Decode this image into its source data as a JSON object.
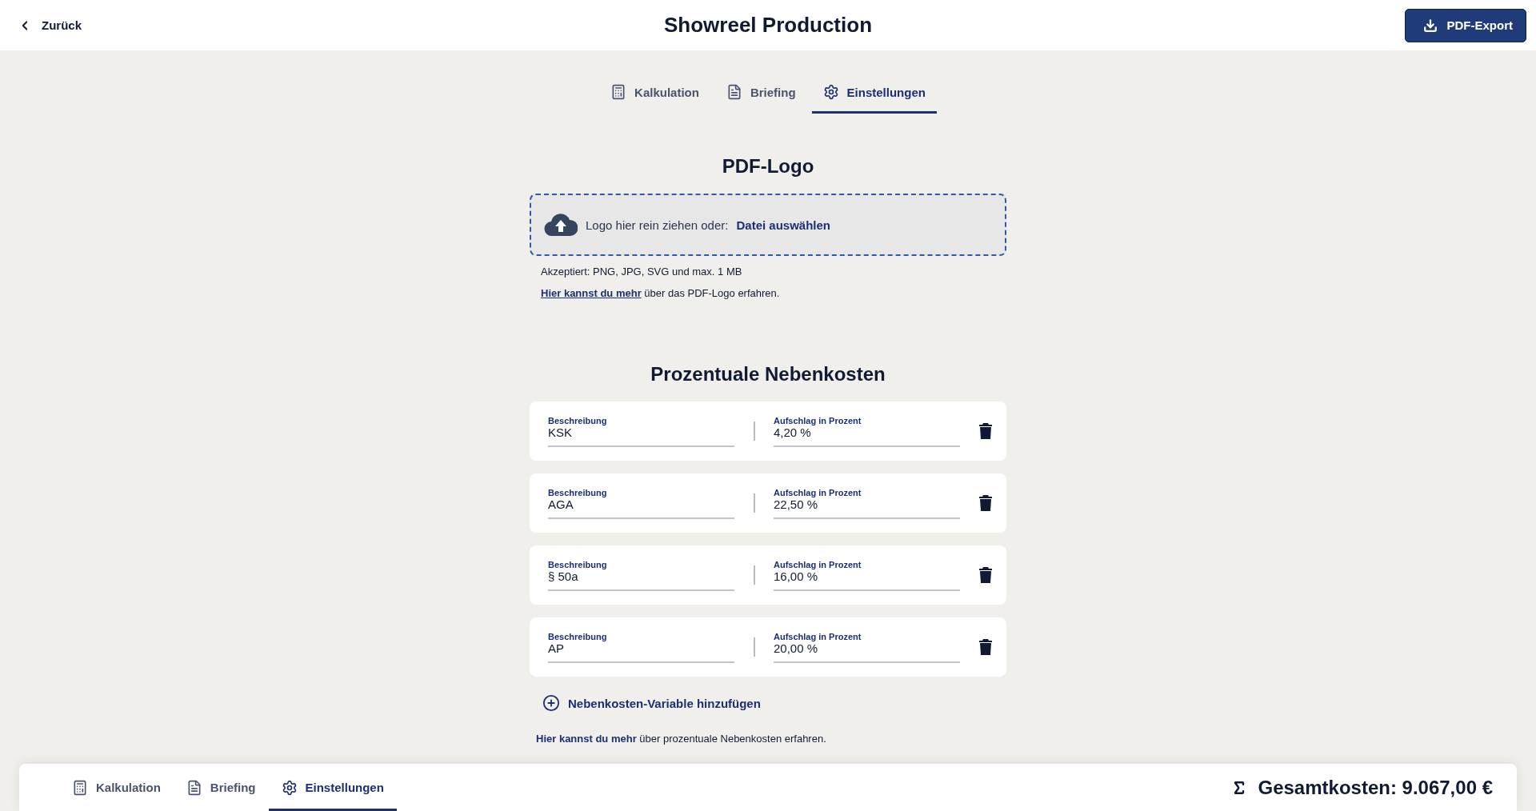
{
  "header": {
    "back": "Zurück",
    "title": "Showreel Production",
    "export_button": "PDF-Export"
  },
  "tabs": [
    {
      "label": "Kalkulation",
      "kind": "calculator",
      "selected": false
    },
    {
      "label": "Briefing",
      "kind": "document",
      "selected": false
    },
    {
      "label": "Einstellungen",
      "kind": "settings",
      "selected": true
    }
  ],
  "logo_section": {
    "title": "PDF-Logo",
    "drop_text": "Logo hier rein ziehen oder:",
    "choose_link": "Datei auswählen",
    "accepted": "Akzeptiert: PNG, JPG, SVG und max. 1 MB",
    "more_link": "Hier kannst du mehr",
    "more_rest": "über das PDF-Logo erfahren."
  },
  "costs_section": {
    "title": "Prozentuale Nebenkosten",
    "rows": [
      {
        "description_label": "Beschreibung",
        "description": "KSK",
        "percent_label": "Aufschlag in Prozent",
        "percent": "4,20 %"
      },
      {
        "description_label": "Beschreibung",
        "description": "AGA",
        "percent_label": "Aufschlag in Prozent",
        "percent": "22,50 %"
      },
      {
        "description_label": "Beschreibung",
        "description": "§ 50a",
        "percent_label": "Aufschlag in Prozent",
        "percent": "16,00 %"
      },
      {
        "description_label": "Beschreibung",
        "description": "AP",
        "percent_label": "Aufschlag in Prozent",
        "percent": "20,00 %"
      }
    ],
    "add_button": "Nebenkosten-Variable hinzufügen",
    "more_link": "Hier kannst du mehr",
    "more_rest": "über prozentuale Nebenkosten erfahren."
  },
  "bottom_bar": {
    "tabs": [
      {
        "label": "Kalkulation",
        "kind": "calculator",
        "selected": false
      },
      {
        "label": "Briefing",
        "kind": "document",
        "selected": false
      },
      {
        "label": "Einstellungen",
        "kind": "settings",
        "selected": true
      }
    ],
    "total": "Gesamtkosten: 9.067,00 €"
  }
}
